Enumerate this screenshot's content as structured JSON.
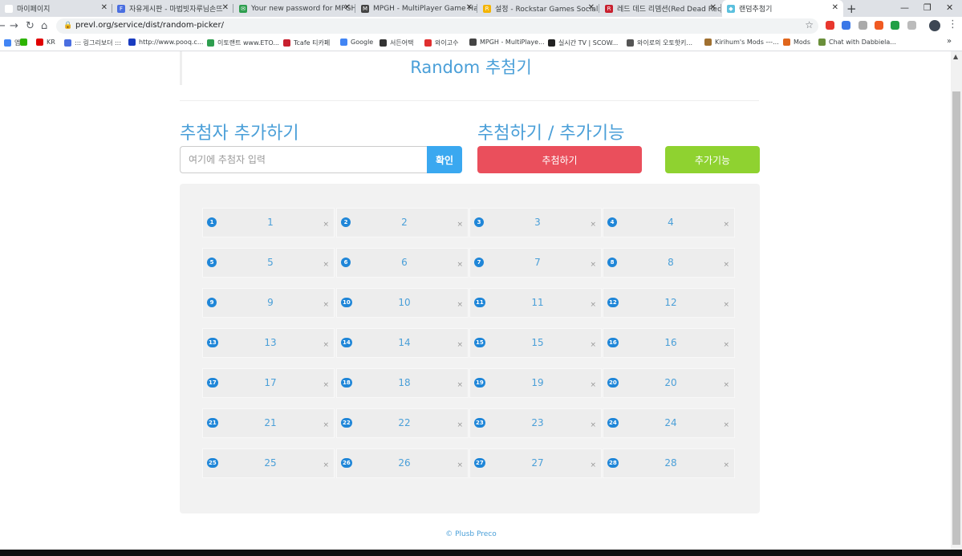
{
  "browser": {
    "tabs": [
      {
        "title": "마이페이지",
        "favicon_color": "#ffffff",
        "favicon_text": ""
      },
      {
        "title": "자유게시판 - 마법빗자루님손뜨",
        "favicon_color": "#4a6ee0",
        "favicon_text": "F"
      },
      {
        "title": "Your new password for MPGH",
        "favicon_color": "#2e9e4f",
        "favicon_text": "✉"
      },
      {
        "title": "MPGH - MultiPlayer Game Hack",
        "favicon_color": "#444444",
        "favicon_text": "M"
      },
      {
        "title": "설정 - Rockstar Games Social C",
        "favicon_color": "#f4b400",
        "favicon_text": "R"
      },
      {
        "title": "레드 데드 리뎀션(Red Dead Red",
        "favicon_color": "#c8202f",
        "favicon_text": "R"
      },
      {
        "title": "랜덤추첨기",
        "favicon_color": "#5bc0de",
        "favicon_text": "◆",
        "active": true
      }
    ],
    "new_tab_label": "+",
    "url": "prevl.org/service/dist/random-picker/",
    "bookmarks": [
      {
        "label": "앱",
        "color": "#4285f4"
      },
      {
        "label": "",
        "color": "#2db400"
      },
      {
        "label": "KR",
        "color": "#e00000"
      },
      {
        "label": "::: 링그리보더 :::",
        "color": "#4a6ee0"
      },
      {
        "label": "http://www.pooq.c...",
        "color": "#1a3cc0"
      },
      {
        "label": "이토랜트 www.ETO...",
        "color": "#2e9e4f"
      },
      {
        "label": "Tcafe 티카페",
        "color": "#c8202f"
      },
      {
        "label": "Google",
        "color": "#4285f4"
      },
      {
        "label": "서든어택",
        "color": "#333333"
      },
      {
        "label": "와이고수",
        "color": "#e03030"
      },
      {
        "label": "MPGH - MultiPlaye...",
        "color": "#444444"
      },
      {
        "label": "실시간 TV | SCOW...",
        "color": "#222222"
      },
      {
        "label": "와이로의 오토핫키...",
        "color": "#555555"
      },
      {
        "label": "Kirihum's Mods ---...",
        "color": "#a07030"
      },
      {
        "label": "Mods",
        "color": "#e0661c"
      },
      {
        "label": "Chat with Dabbiela...",
        "color": "#6a8f3a"
      }
    ],
    "bookmarks_more": "»"
  },
  "page": {
    "title": "Random 추첨기",
    "add_section_title": "추첨자 추가하기",
    "draw_section_title": "추첨하기 / 추가기능",
    "input_placeholder": "여기에 추첨자 입력",
    "confirm_label": "확인",
    "draw_label": "추첨하기",
    "extra_label": "추가기능",
    "remove_label": "×",
    "entries": [
      "1",
      "2",
      "3",
      "4",
      "5",
      "6",
      "7",
      "8",
      "9",
      "10",
      "11",
      "12",
      "13",
      "14",
      "15",
      "16",
      "17",
      "18",
      "19",
      "20",
      "21",
      "22",
      "23",
      "24",
      "25",
      "26",
      "27",
      "28"
    ],
    "footer": "© Plusb Preco"
  },
  "colors": {
    "accent": "#4a9fd8",
    "badge": "#1f86d8",
    "confirm": "#3aa8f0",
    "draw": "#ea4f5c",
    "extra": "#8fd230"
  }
}
